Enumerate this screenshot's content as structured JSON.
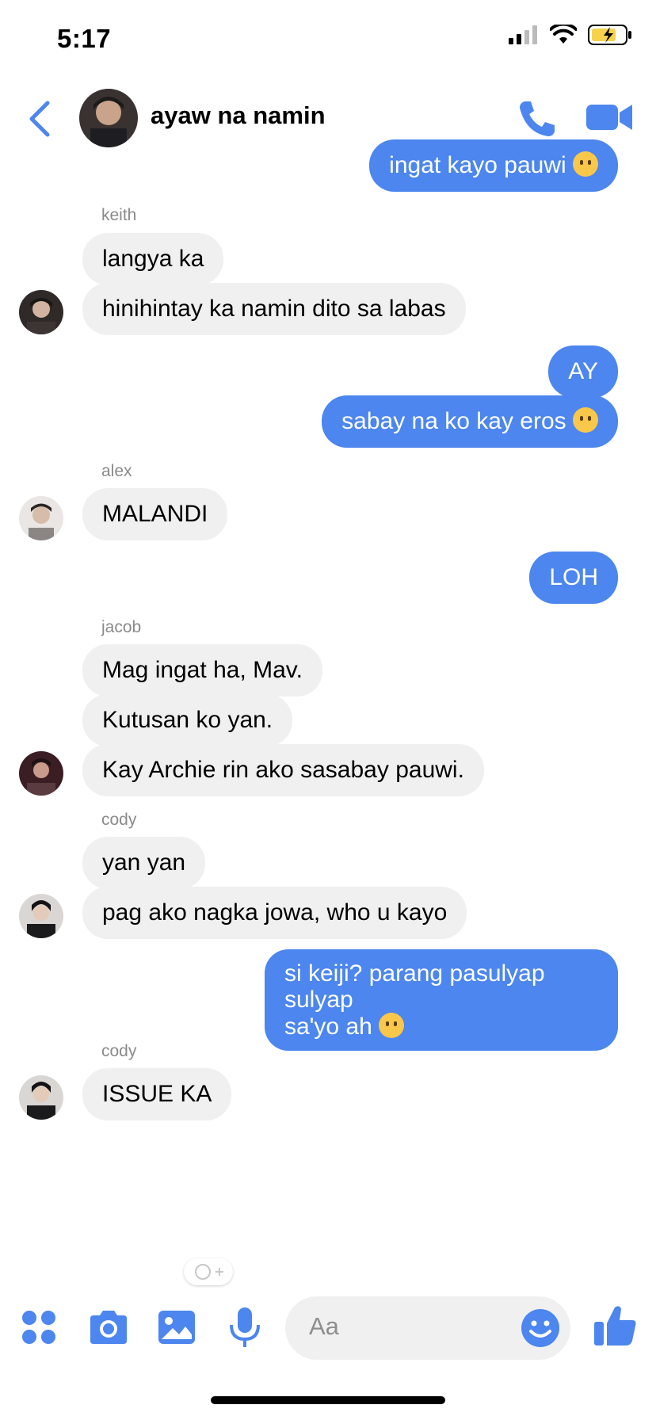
{
  "status": {
    "time": "5:17"
  },
  "header": {
    "title": "ayaw na namin"
  },
  "messages": {
    "m1": "ingat kayo pauwi",
    "keith_name": "keith",
    "m2": "langya ka",
    "m3": "hinihintay ka namin dito sa labas",
    "m4": "AY",
    "m5": "sabay na ko kay eros",
    "alex_name": "alex",
    "m6": "MALANDI",
    "m7": "LOH",
    "jacob_name": "jacob",
    "m8": "Mag ingat ha, Mav.",
    "m9": "Kutusan ko yan.",
    "m10": "Kay Archie rin ako sasabay pauwi.",
    "cody_name1": "cody",
    "m11": "yan yan",
    "m12": "pag ako nagka jowa, who u kayo",
    "m13_line1": "si keiji? parang pasulyap sulyap",
    "m13_line2": "sa'yo ah",
    "cody_name2": "cody",
    "m14": "ISSUE KA"
  },
  "composer": {
    "placeholder": "Aa"
  },
  "colors": {
    "accent": "#4C86EE",
    "bubble_in": "#F0F0F0"
  },
  "icons": [
    "back-chevron-icon",
    "phone-icon",
    "video-camera-icon",
    "apps-grid-icon",
    "camera-icon",
    "gallery-icon",
    "microphone-icon",
    "emoji-icon",
    "thumbs-up-icon"
  ]
}
